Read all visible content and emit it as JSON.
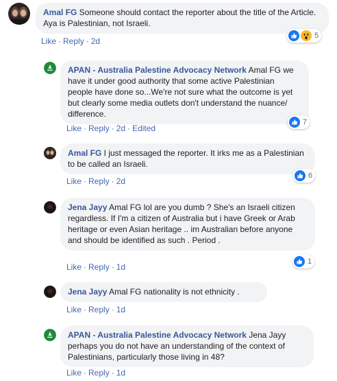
{
  "comments": [
    {
      "author": "Amal FG",
      "text": " Someone should contact the reporter about the title of the Article. Aya is Palestinian, not Israeli.",
      "like": "Like",
      "reply": "Reply",
      "time": "2d",
      "reactions": {
        "icons": [
          "like-icon",
          "wow-icon"
        ],
        "count": "5"
      }
    },
    {
      "author": "APAN - Australia Palestine Advocacy Network",
      "text": " Amal FG we have it under good authority that some active Palestinian people have done so...We're not sure what the outcome is yet but clearly some media outlets don't understand the nuance/ difference.",
      "like": "Like",
      "reply": "Reply",
      "time": "2d",
      "edited": "Edited",
      "reactions": {
        "icons": [
          "like-icon"
        ],
        "count": "7"
      }
    },
    {
      "author": "Amal FG",
      "text": " I just messaged the reporter. It irks me as a Palestinian to be called an Israeli.",
      "like": "Like",
      "reply": "Reply",
      "time": "2d",
      "reactions": {
        "icons": [
          "like-icon"
        ],
        "count": "6"
      }
    },
    {
      "author": "Jena Jayy",
      "text": " Amal FG lol are you dumb ? She's an Israeli citizen regardless. If I'm a citizen of Australia but i have Greek or Arab heritage or even Asian heritage .. im Australian before anyone and should be identified as such . Period .",
      "like": "Like",
      "reply": "Reply",
      "time": "1d",
      "reactions": {
        "icons": [
          "like-icon"
        ],
        "count": "1"
      }
    },
    {
      "author": "Jena Jayy",
      "text": " Amal FG nationality is not ethnicity .",
      "like": "Like",
      "reply": "Reply",
      "time": "1d"
    },
    {
      "author": "APAN - Australia Palestine Advocacy Network",
      "text": " Jena Jayy perhaps you do not have an understanding of the context of Palestinians, particularly those living in 48?",
      "like": "Like",
      "reply": "Reply",
      "time": "1d"
    }
  ],
  "colors": {
    "link": "#385898",
    "action": "#4267b2",
    "bubble": "#f2f3f5",
    "like_blue": "#1877f2",
    "wow_yellow": "#f7b928",
    "apan_green": "#1f8a3a"
  }
}
